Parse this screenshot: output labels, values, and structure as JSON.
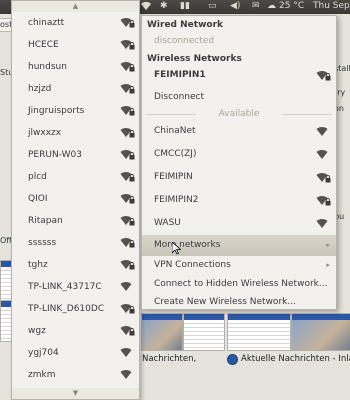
{
  "topbar": {
    "volume_icon": "speaker-icon",
    "mail_icon": "envelope-icon",
    "weather_icon": "cloud-icon",
    "temperature": "25 °C",
    "clock": "Thu Sep"
  },
  "background": {
    "tab_fragment": "ost",
    "left_fragments": [
      "Stu",
      "Offi"
    ],
    "right_fragments": [
      "nstall",
      "ntry",
      "vpn",
      "ubu"
    ],
    "bottom_left": "Nachrichten,",
    "bottom_right": "Aktuelle Nachrichten - Inland"
  },
  "left_menu": {
    "scroll_up": "▲",
    "scroll_down": "▼",
    "networks": [
      {
        "ssid": "chinaztt",
        "secured": true
      },
      {
        "ssid": "HCECE",
        "secured": true
      },
      {
        "ssid": "hundsun",
        "secured": true
      },
      {
        "ssid": "hzjzd",
        "secured": true
      },
      {
        "ssid": "Jingruisports",
        "secured": true
      },
      {
        "ssid": "jlwxxzx",
        "secured": true
      },
      {
        "ssid": "PERUN-W03",
        "secured": true
      },
      {
        "ssid": "plcd",
        "secured": true
      },
      {
        "ssid": "QIOI",
        "secured": true
      },
      {
        "ssid": "Ritapan",
        "secured": true
      },
      {
        "ssid": "ssssss",
        "secured": true
      },
      {
        "ssid": "tghz",
        "secured": true
      },
      {
        "ssid": "TP-LINK_43717C",
        "secured": false
      },
      {
        "ssid": "TP-LINK_D610DC",
        "secured": true
      },
      {
        "ssid": "wgz",
        "secured": true
      },
      {
        "ssid": "ygj704",
        "secured": false
      },
      {
        "ssid": "zmkm",
        "secured": false
      }
    ]
  },
  "right_menu": {
    "wired_header": "Wired Network",
    "wired_status": "disconnected",
    "wireless_header": "Wireless Networks",
    "connected_ssid": "FEIMIPIN1",
    "disconnect_label": "Disconnect",
    "available_label": "Available",
    "available": [
      {
        "ssid": "ChinaNet",
        "secured": false
      },
      {
        "ssid": "CMCC(ZJ)",
        "secured": false
      },
      {
        "ssid": "FEIMIPIN",
        "secured": true
      },
      {
        "ssid": "FEIMIPIN2",
        "secured": true
      },
      {
        "ssid": "WASU",
        "secured": false
      }
    ],
    "more_networks": "More networks",
    "vpn_connections": "VPN Connections",
    "connect_hidden": "Connect to Hidden Wireless Network...",
    "create_new": "Create New Wireless Network...",
    "submenu_arrow": "▸"
  }
}
